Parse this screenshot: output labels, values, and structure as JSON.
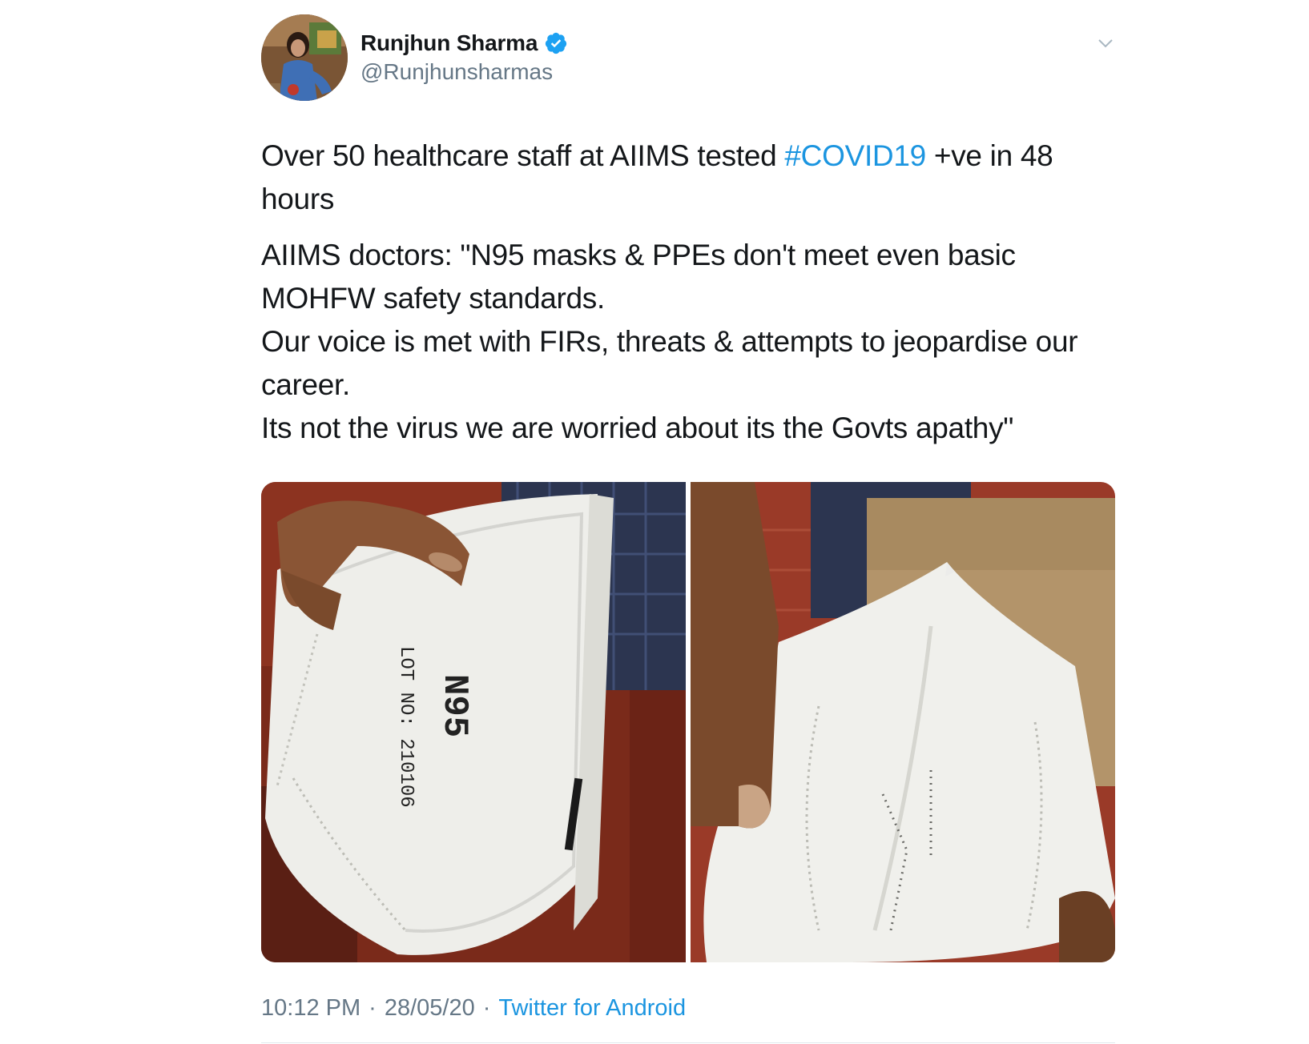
{
  "author": {
    "display_name": "Runjhun Sharma",
    "handle": "@Runjhunsharmas",
    "verified": true,
    "avatar_icon": "profile-photo"
  },
  "tweet": {
    "line1_before": "Over 50 healthcare staff at AIIMS tested ",
    "hashtag": "#COVID19",
    "line1_after": " +ve in 48 hours",
    "para2_line1": "AIIMS doctors: \"N95 masks & PPEs don't meet even basic MOHFW safety standards.",
    "para2_line2": "Our voice is met with FIRs, threats & attempts to jeopardise our career.",
    "para2_line3": "Its not the virus we are worried about its  the Govts apathy\""
  },
  "media": {
    "photo1_mask_text": "N95",
    "photo1_lot_text": "LOT NO: 210106"
  },
  "meta": {
    "time": "10:12 PM",
    "date": "28/05/20",
    "source": "Twitter for Android",
    "separator": "·"
  },
  "colors": {
    "link": "#1b95e0",
    "secondary_text": "#657786",
    "primary_text": "#14171a",
    "verified_badge": "#1da1f2"
  }
}
